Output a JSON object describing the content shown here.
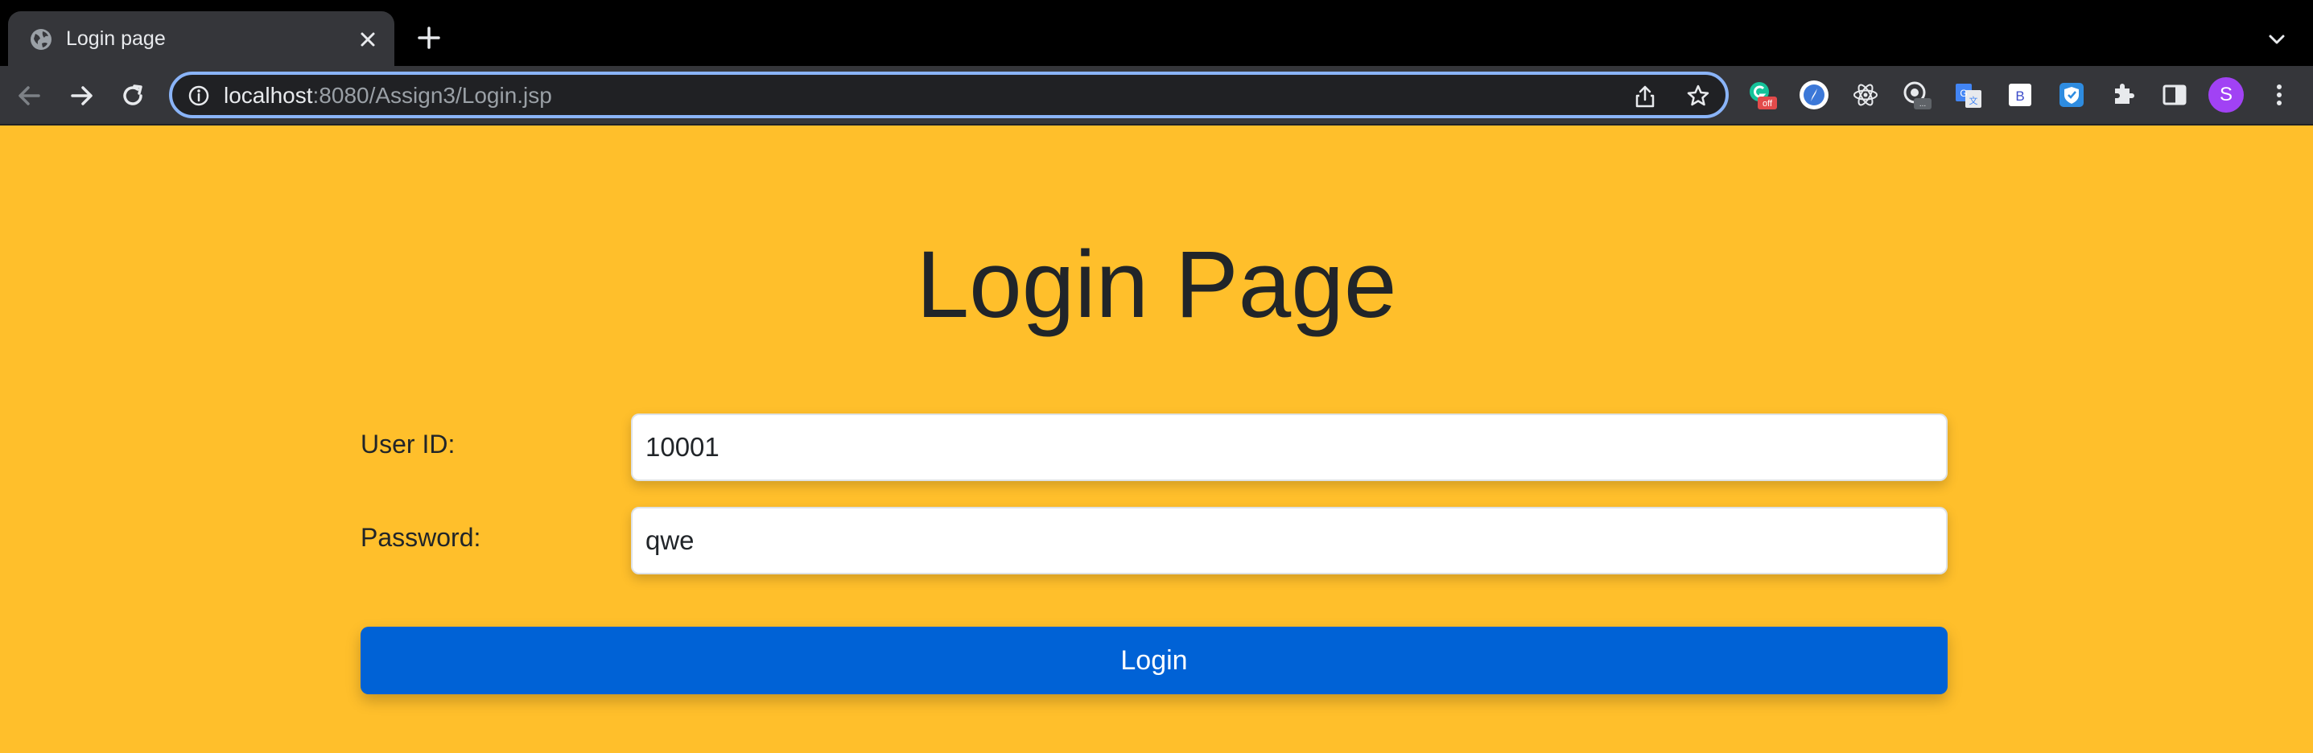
{
  "browser": {
    "tab": {
      "title": "Login page"
    },
    "address": {
      "host": "localhost",
      "path": ":8080/Assign3/Login.jsp"
    },
    "extensions": [
      {
        "name": "grammarly-icon",
        "badge": "off"
      },
      {
        "name": "compass-extension-icon",
        "badge": ""
      },
      {
        "name": "react-devtools-icon",
        "badge": ""
      },
      {
        "name": "monitor-extension-icon",
        "badge": "..."
      },
      {
        "name": "google-translate-icon",
        "badge": ""
      },
      {
        "name": "bootstrap-extension-icon",
        "badge": "B"
      },
      {
        "name": "shield-extension-icon",
        "badge": ""
      }
    ],
    "profile_initial": "S",
    "colors": {
      "tab_bar": "#000000",
      "toolbar": "#35363a",
      "omnibox_focus": "#8ab4f8",
      "profile": "#a142f4"
    }
  },
  "page": {
    "title": "Login Page",
    "form": {
      "user_id_label": "User ID:",
      "user_id_value": "10001",
      "password_label": "Password:",
      "password_value": "qwe",
      "submit_label": "Login"
    },
    "colors": {
      "background": "#ffbf2b",
      "button": "#0062d6",
      "text": "#212529"
    }
  }
}
